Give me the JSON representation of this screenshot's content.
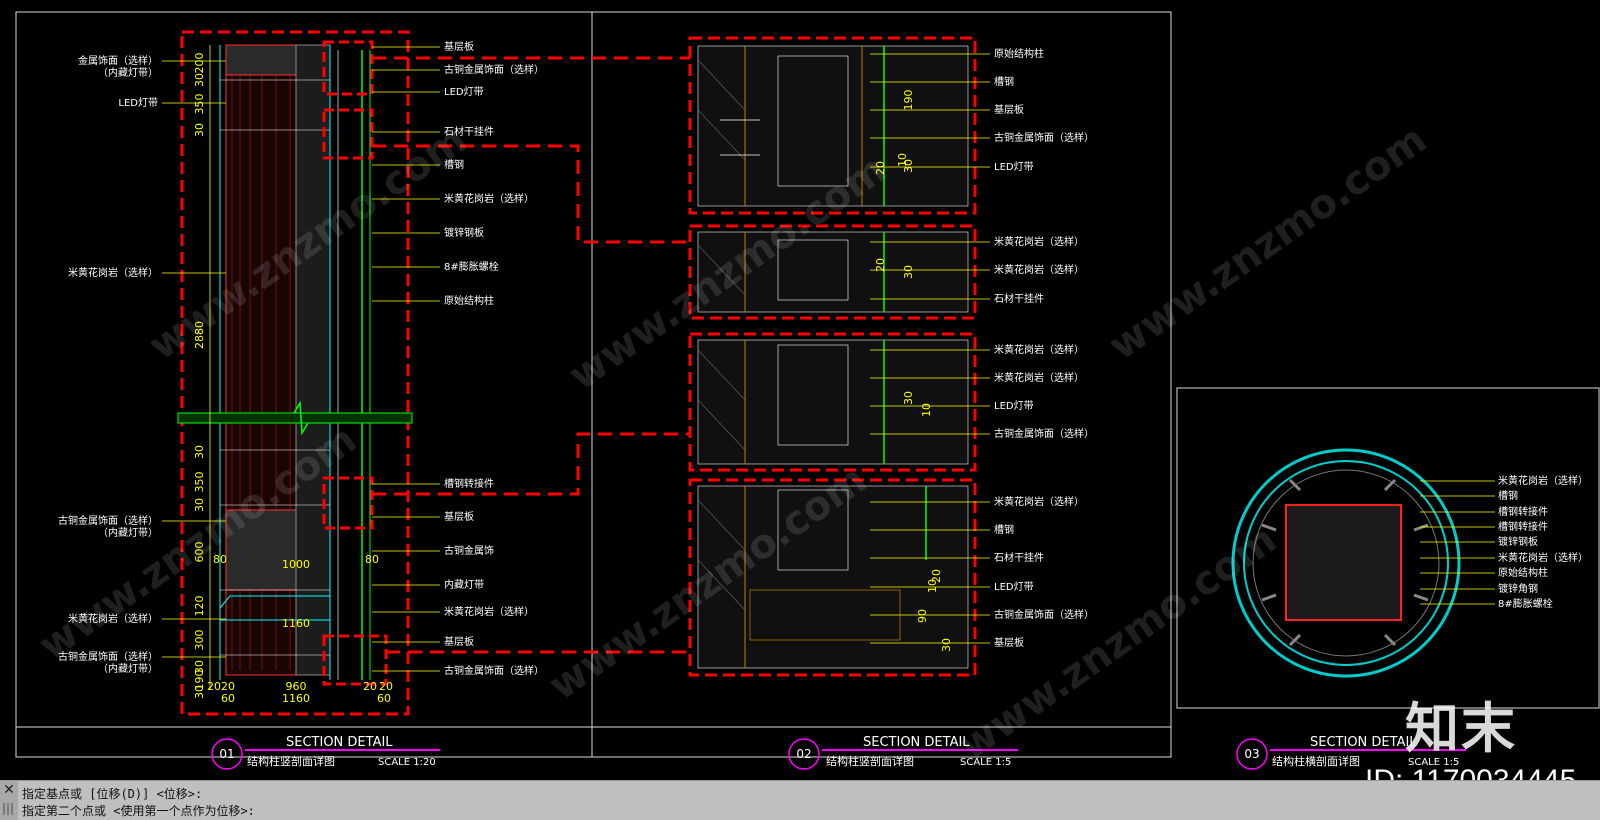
{
  "panels": [
    {
      "num": "01",
      "title": "SECTION DETAIL",
      "subtitle": "结构柱竖剖面详图",
      "scale": "SCALE 1:20"
    },
    {
      "num": "02",
      "title": "SECTION DETAIL",
      "subtitle": "结构柱竖剖面详图",
      "scale": "SCALE 1:5"
    },
    {
      "num": "03",
      "title": "SECTION DETAIL",
      "subtitle": "结构柱横剖面详图",
      "scale": "SCALE 1:5"
    }
  ],
  "labels_p1_left": [
    "金属饰面（选样）",
    "（内藏灯带）",
    "LED灯带",
    "米黄花岗岩（选样）",
    "古铜金属饰面（选样）",
    "（内藏灯带）",
    "米黄花岗岩（选样）",
    "古铜金属饰面（选样）",
    "（内藏灯带）"
  ],
  "labels_p1_right": [
    "基层板",
    "古铜金属饰面（选样）",
    "LED灯带",
    "石材干挂件",
    "槽钢",
    "米黄花岗岩（选样）",
    "镀锌钢板",
    "8#膨胀螺栓",
    "原始结构柱",
    "槽钢转接件",
    "基层板",
    "古铜金属饰",
    "内藏灯带",
    "米黄花岗岩（选样）",
    "基层板",
    "古铜金属饰面（选样）"
  ],
  "dims_p1": [
    "200",
    "30",
    "350",
    "30",
    "2880",
    "30",
    "350",
    "30",
    "600",
    "120",
    "300",
    "30",
    "190",
    "30",
    "80",
    "1000",
    "80",
    "1160",
    "20",
    "20",
    "960",
    "20",
    "20",
    "60",
    "1160",
    "60"
  ],
  "labels_p2": [
    "原始结构柱",
    "槽钢",
    "基层板",
    "古铜金属饰面（选样）",
    "LED灯带",
    "米黄花岗岩（选样）",
    "米黄花岗岩（选样）",
    "石材干挂件",
    "米黄花岗岩（选样）",
    "米黄花岗岩（选样）",
    "LED灯带",
    "古铜金属饰面（选样）",
    "米黄花岗岩（选样）",
    "槽钢",
    "石材干挂件",
    "LED灯带",
    "古铜金属饰面（选样）",
    "基层板"
  ],
  "dims_p2": [
    "190",
    "10",
    "30",
    "20",
    "30",
    "10",
    "30",
    "20",
    "10",
    "20",
    "90",
    "30"
  ],
  "labels_p3": [
    "米黄花岗岩（选样）",
    "槽钢",
    "槽钢转接件",
    "槽钢转接件",
    "镀锌钢板",
    "米黄花岗岩（选样）",
    "原始结构柱",
    "镀锌角钢",
    "8#膨胀螺栓"
  ],
  "watermark": "www.znzmo.com",
  "logo_text": "知末",
  "id_text": "ID: 1170034445",
  "command": {
    "line1": "指定基点或 [位移(D)] <位移>:",
    "line2": "指定第二个点或 <使用第一个点作为位移>:"
  },
  "colors": {
    "bg": "#000000",
    "red": "#ff0000",
    "yellow": "#ffff00",
    "cyan": "#00ffff",
    "green": "#00ff00",
    "magenta": "#ff00ff",
    "white": "#ffffff"
  }
}
